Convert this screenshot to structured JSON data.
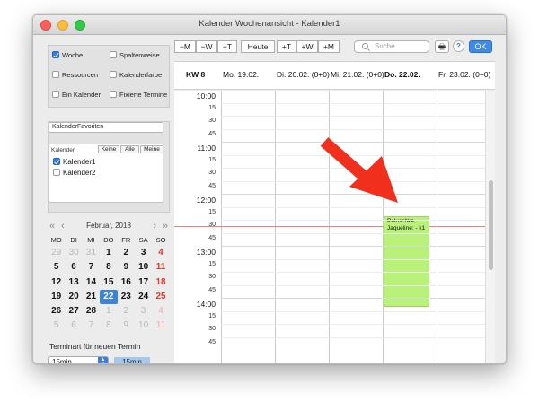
{
  "window": {
    "title": "Kalender Wochenansicht - Kalender1"
  },
  "options": [
    {
      "label": "Woche",
      "checked": true
    },
    {
      "label": "Spaltenweise",
      "checked": false
    },
    {
      "label": "Ressourcen",
      "checked": false
    },
    {
      "label": "Kalenderfarbe",
      "checked": false
    },
    {
      "label": "Ein Kalender",
      "checked": false
    },
    {
      "label": "Fixierte Termine",
      "checked": false
    }
  ],
  "favorites": {
    "value": "KalenderFavoriten"
  },
  "kalender": {
    "header": "Kalender",
    "buttons": [
      "Keine",
      "Alle",
      "Meine"
    ],
    "items": [
      {
        "label": "Kalender1",
        "checked": true
      },
      {
        "label": "Kalender2",
        "checked": false
      }
    ]
  },
  "minical": {
    "month": "Februar, 2018",
    "weekdays": [
      "MO",
      "DI",
      "MI",
      "DO",
      "FR",
      "SA",
      "SO"
    ],
    "weeks": [
      [
        "29",
        "30",
        "31",
        "1",
        "2",
        "3",
        "4"
      ],
      [
        "5",
        "6",
        "7",
        "8",
        "9",
        "10",
        "11"
      ],
      [
        "12",
        "13",
        "14",
        "15",
        "16",
        "17",
        "18"
      ],
      [
        "19",
        "20",
        "21",
        "22",
        "23",
        "24",
        "25"
      ],
      [
        "26",
        "27",
        "28",
        "1",
        "2",
        "3",
        "4"
      ],
      [
        "5",
        "6",
        "7",
        "8",
        "9",
        "10",
        "11"
      ]
    ],
    "selected": "22"
  },
  "terminart": {
    "label": "Terminart für neuen Termin",
    "value": "15min",
    "chip": "15min"
  },
  "toolbar": {
    "buttons": [
      "−M",
      "−W",
      "−T",
      "Heute",
      "+T",
      "+W",
      "+M"
    ],
    "search_placeholder": "Suche",
    "ok": "OK",
    "help": "?",
    "print": "🖶"
  },
  "week": {
    "label": "KW 8",
    "days": [
      {
        "label": "Mo. 19.02.",
        "bold": false
      },
      {
        "label": "Di. 20.02. (0+0)",
        "bold": false
      },
      {
        "label": "Mi. 21.02. (0+0)",
        "bold": false
      },
      {
        "label": "Do. 22.02.",
        "bold": true
      },
      {
        "label": "Fr. 23.02. (0+0)",
        "bold": false
      }
    ]
  },
  "times": [
    "10:00",
    "15",
    "30",
    "45",
    "11:00",
    "15",
    "30",
    "45",
    "12:00",
    "15",
    "30",
    "45",
    "13:00",
    "15",
    "30",
    "45",
    "14:00",
    "15",
    "30",
    "45"
  ],
  "event": {
    "text": "Paluschke, Jaqueline: - k1",
    "color": "#b9f17a"
  },
  "colors": {
    "accent": "#3d84d8",
    "sunday": "#e13a2c",
    "now_line": "#e9847a",
    "arrow": "#f0301c"
  }
}
